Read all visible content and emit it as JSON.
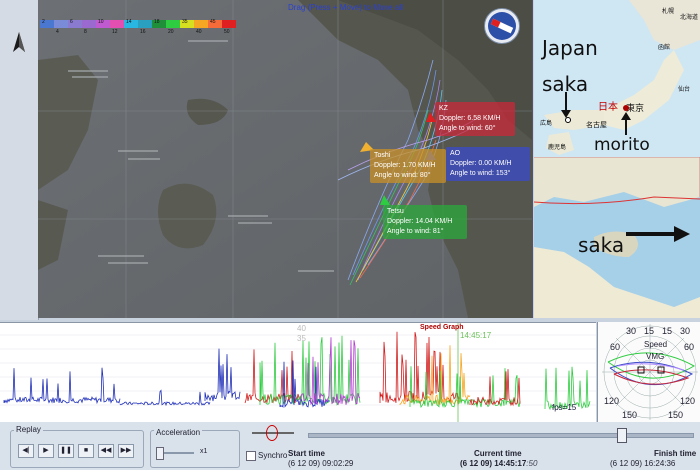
{
  "map": {
    "drag_hint": "Drag (Press + Move) to Move all",
    "speed_scale": [
      "2",
      "4",
      "6",
      "8",
      "10",
      "12",
      "14",
      "16",
      "18",
      "20",
      "35",
      "40",
      "45",
      "50"
    ],
    "scale_colors": [
      "#4a78d0",
      "#7a8cd8",
      "#8a7ad0",
      "#9a6ad0",
      "#c05ad0",
      "#e24fb0",
      "#29b6e0",
      "#2aa0c0",
      "#1f8f3a",
      "#2ecc40",
      "#d6e020",
      "#f5a623",
      "#f56b3a",
      "#e02020"
    ],
    "tags": [
      {
        "name": "KZ",
        "doppler": "Doppler: 6.58 KM/H",
        "angle": "Angle to wind: 60°",
        "color": "#c8283a"
      },
      {
        "name": "AO",
        "doppler": "Doppler: 0.00 KM/H",
        "angle": "Angle to wind: 153°",
        "color": "#3a49c8"
      },
      {
        "name": "Toshi",
        "doppler": "Doppler: 1.70 KM/H",
        "angle": "Angle to wind: 80°",
        "color": "#c89028"
      },
      {
        "name": "Tetsu",
        "doppler": "Doppler: 14.04 KM/H",
        "angle": "Angle to wind: 81°",
        "color": "#2aa83a"
      }
    ]
  },
  "inset_top": {
    "label_japan": "Japan",
    "label_saka": "saka",
    "label_morito": "morito",
    "jp_labels": [
      "札幌",
      "北海道",
      "函館",
      "仙台",
      "日本",
      "東京",
      "名古屋",
      "広島",
      "鹿児島"
    ]
  },
  "inset_bottom": {
    "label_saka": "saka"
  },
  "graph": {
    "title": "Speed Graph",
    "cursor_time": "14:45:17",
    "tick_40": "40",
    "tick_35": "35",
    "fps": "fps=15"
  },
  "polar": {
    "labels": [
      "30",
      "15",
      "15",
      "30",
      "60",
      "60",
      "120",
      "120",
      "150",
      "150"
    ],
    "speed_label": "Speed",
    "vmg_label": "VMG"
  },
  "controls": {
    "replay_label": "Replay",
    "acceleration_label": "Acceleration",
    "accel_value": "x1",
    "synchro_label": "Synchro",
    "start_label": "Start time",
    "start_value": "(6 12 09) 09:02:29",
    "current_label": "Current time",
    "current_value": "(6 12 09) 14:45:17",
    "current_suffix": ":50",
    "finish_label": "Finish time",
    "finish_value": "(6 12 09) 16:24:36",
    "progress": 0.82
  }
}
